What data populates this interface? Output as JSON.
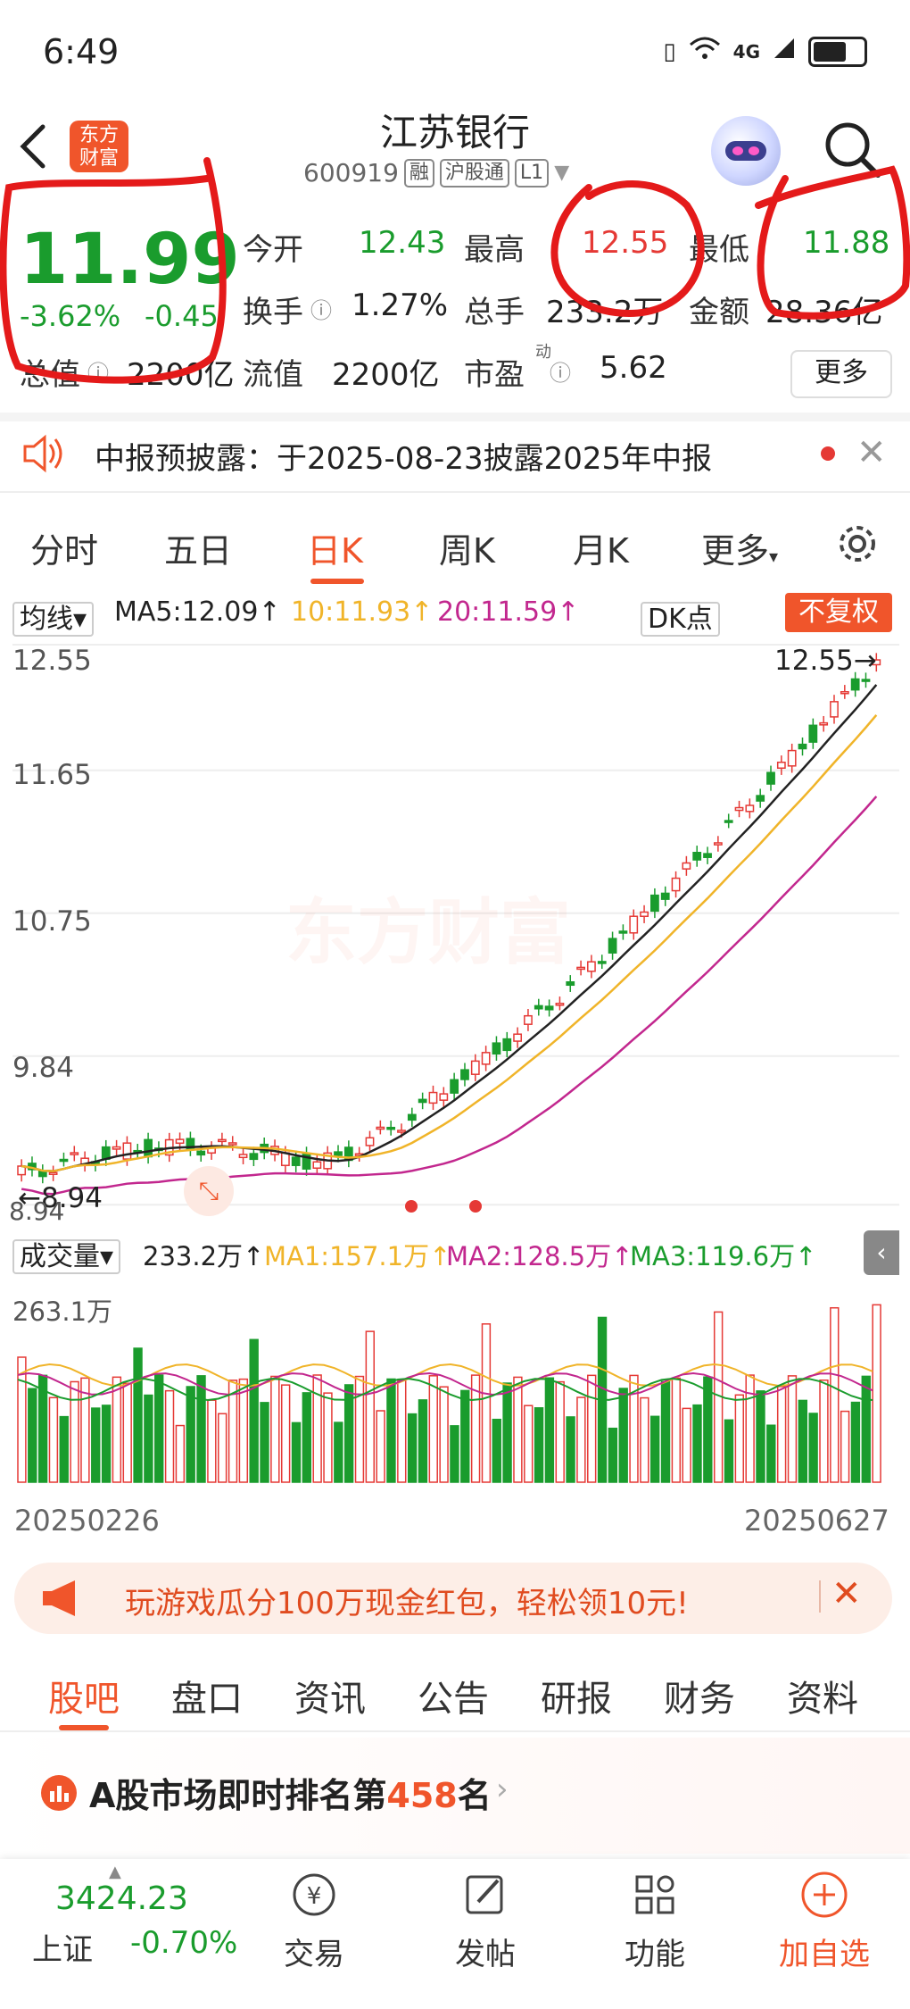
{
  "status_bar": {
    "time": "6:49",
    "network": "4G"
  },
  "header": {
    "logo_text_1": "东方",
    "logo_text_2": "财富",
    "title": "江苏银行",
    "code": "600919",
    "tags": [
      "融",
      "沪股通",
      "L1"
    ]
  },
  "quote": {
    "price": "11.99",
    "change_pct": "-3.62%",
    "change_abs": "-0.45",
    "open_label": "今开",
    "open": "12.43",
    "high_label": "最高",
    "high": "12.55",
    "low_label": "最低",
    "low": "11.88",
    "turnover_label": "换手",
    "turnover": "1.27%",
    "volume_label": "总手",
    "volume": "233.2万",
    "amount_label": "金额",
    "amount": "28.36亿",
    "mktcap_label": "总值",
    "mktcap": "2200亿",
    "float_label": "流值",
    "float": "2200亿",
    "pe_label": "市盈",
    "pe_sup": "动",
    "pe": "5.62",
    "more_label": "更多"
  },
  "notice": {
    "text": "中报预披露：于2025-08-23披露2025年中报"
  },
  "chart_tabs": [
    "分时",
    "五日",
    "日K",
    "周K",
    "月K",
    "更多"
  ],
  "chart_tab_active": "日K",
  "ma_bar": {
    "selector": "均线",
    "ma5": "MA5:12.09↑",
    "ma10": "10:11.93↑",
    "ma20": "20:11.59↑",
    "dk": "DK点",
    "adjust": "不复权"
  },
  "kline": {
    "y_ticks": [
      "12.55",
      "11.65",
      "10.75",
      "9.84",
      "8.94"
    ],
    "high_mark": "12.55",
    "low_mark": "8.94",
    "watermark": "东方财富"
  },
  "volume_bar": {
    "selector": "成交量",
    "vol": "233.2万↑",
    "ma1": "MA1:157.1万↑",
    "ma2": "MA2:128.5万↑",
    "ma3": "MA3:119.6万↑",
    "max": "263.1万",
    "start_date": "20250226",
    "end_date": "20250627"
  },
  "promo": {
    "text": "玩游戏瓜分100万现金红包，轻松领10元!"
  },
  "bottom_tabs": [
    "股吧",
    "盘口",
    "资讯",
    "公告",
    "研报",
    "财务",
    "资料"
  ],
  "rank": {
    "prefix": "A股市场即时排名第",
    "rank": "458",
    "suffix": "名"
  },
  "bottom_nav": {
    "index_value": "3424.23",
    "index_name": "上证",
    "index_change": "-0.70%",
    "trade": "交易",
    "post": "发帖",
    "functions": "功能",
    "add_watch": "加自选"
  },
  "colors": {
    "up": "#e53935",
    "down": "#1a9c2d",
    "accent": "#f0552b",
    "ma10": "#f0b429",
    "ma20": "#c2278e"
  }
}
